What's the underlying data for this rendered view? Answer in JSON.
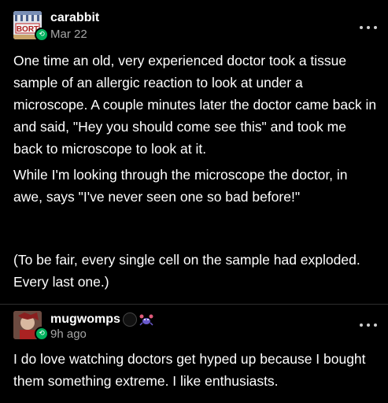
{
  "posts": [
    {
      "username": "carabbit",
      "timestamp": "Mar 22",
      "avatar_text": "BORT",
      "paragraphs": [
        "One time an old, very experienced doctor took a tissue sample of an allergic reaction to look at under a microscope. A couple minutes later the doctor came back in and said, \"Hey you should come see this\" and took me back to microscope to look at it.",
        "While I'm looking through the microscope the doctor, in awe, says \"I've never seen one so bad before!\"",
        "(To be fair, every single cell on the sample had exploded. Every last one.)"
      ]
    },
    {
      "username": "mugwomps",
      "timestamp": "9h ago",
      "paragraphs": [
        "I do love watching doctors get hyped up because I bought them something extreme. I like enthusiasts."
      ]
    }
  ],
  "colors": {
    "background": "#000000",
    "text": "#ffffff",
    "muted": "#a6a6a6",
    "reblog_green": "#00b05c",
    "divider": "#2e2e2e"
  },
  "icons": {
    "more": "more-options-icon",
    "reblog": "reblog-icon"
  }
}
